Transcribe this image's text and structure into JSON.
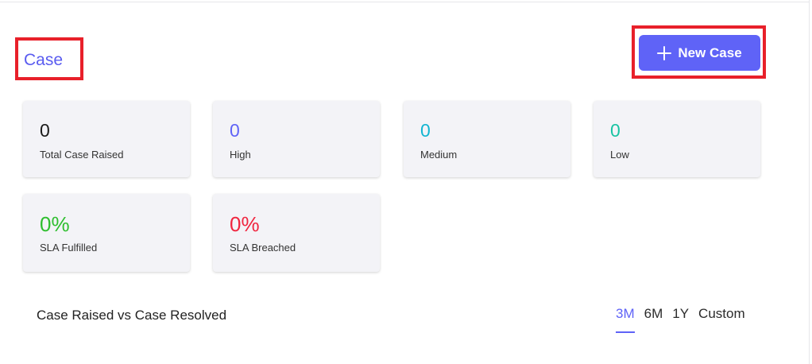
{
  "header": {
    "title": "Case",
    "new_case_label": "New Case"
  },
  "stats": [
    {
      "value": "0",
      "label": "Total Case Raised",
      "color": "#1a1a1a"
    },
    {
      "value": "0",
      "label": "High",
      "color": "#5f63f7"
    },
    {
      "value": "0",
      "label": "Medium",
      "color": "#13b5d1"
    },
    {
      "value": "0",
      "label": "Low",
      "color": "#19c3a3"
    },
    {
      "value": "0%",
      "label": "SLA Fulfilled",
      "color": "#2ebe2e"
    },
    {
      "value": "0%",
      "label": "SLA Breached",
      "color": "#f0253f"
    }
  ],
  "chart_section": {
    "title": "Case Raised vs Case Resolved",
    "ranges": [
      "3M",
      "6M",
      "1Y",
      "Custom"
    ],
    "active_range": "3M"
  },
  "colors": {
    "accent": "#5f63f7",
    "highlight_box": "#e8202a",
    "card_bg": "#f3f3f7"
  }
}
